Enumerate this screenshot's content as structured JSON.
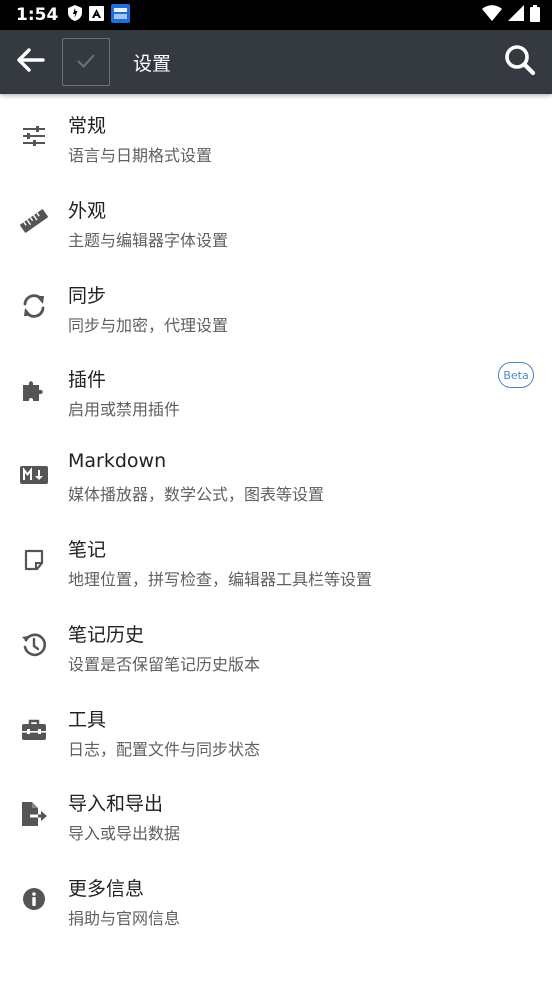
{
  "status_bar": {
    "time": "1:54",
    "icons": [
      "shield-icon",
      "a-letter-icon",
      "app-notification-icon",
      "wifi-icon",
      "signal-icon",
      "battery-icon"
    ]
  },
  "app_bar": {
    "title": "设置",
    "back_icon": "arrow-left-icon",
    "check_icon": "check-icon",
    "search_icon": "search-icon",
    "background_color": "#343a40"
  },
  "settings": {
    "items": [
      {
        "title": "常规",
        "subtitle": "语言与日期格式设置",
        "icon": "sliders-icon"
      },
      {
        "title": "外观",
        "subtitle": "主题与编辑器字体设置",
        "icon": "ruler-icon"
      },
      {
        "title": "同步",
        "subtitle": "同步与加密，代理设置",
        "icon": "sync-icon"
      },
      {
        "title": "插件",
        "subtitle": "启用或禁用插件",
        "icon": "puzzle-icon",
        "badge": "Beta"
      },
      {
        "title": "Markdown",
        "subtitle": "媒体播放器，数学公式，图表等设置",
        "icon": "markdown-icon"
      },
      {
        "title": "笔记",
        "subtitle": "地理位置，拼写检查，编辑器工具栏等设置",
        "icon": "note-icon"
      },
      {
        "title": "笔记历史",
        "subtitle": "设置是否保留笔记历史版本",
        "icon": "history-icon"
      },
      {
        "title": "工具",
        "subtitle": "日志，配置文件与同步状态",
        "icon": "toolbox-icon"
      },
      {
        "title": "导入和导出",
        "subtitle": "导入或导出数据",
        "icon": "file-export-icon"
      },
      {
        "title": "更多信息",
        "subtitle": "捐助与官网信息",
        "icon": "info-icon"
      }
    ]
  },
  "colors": {
    "icon": "#555555",
    "badge": "#4a86c5"
  }
}
